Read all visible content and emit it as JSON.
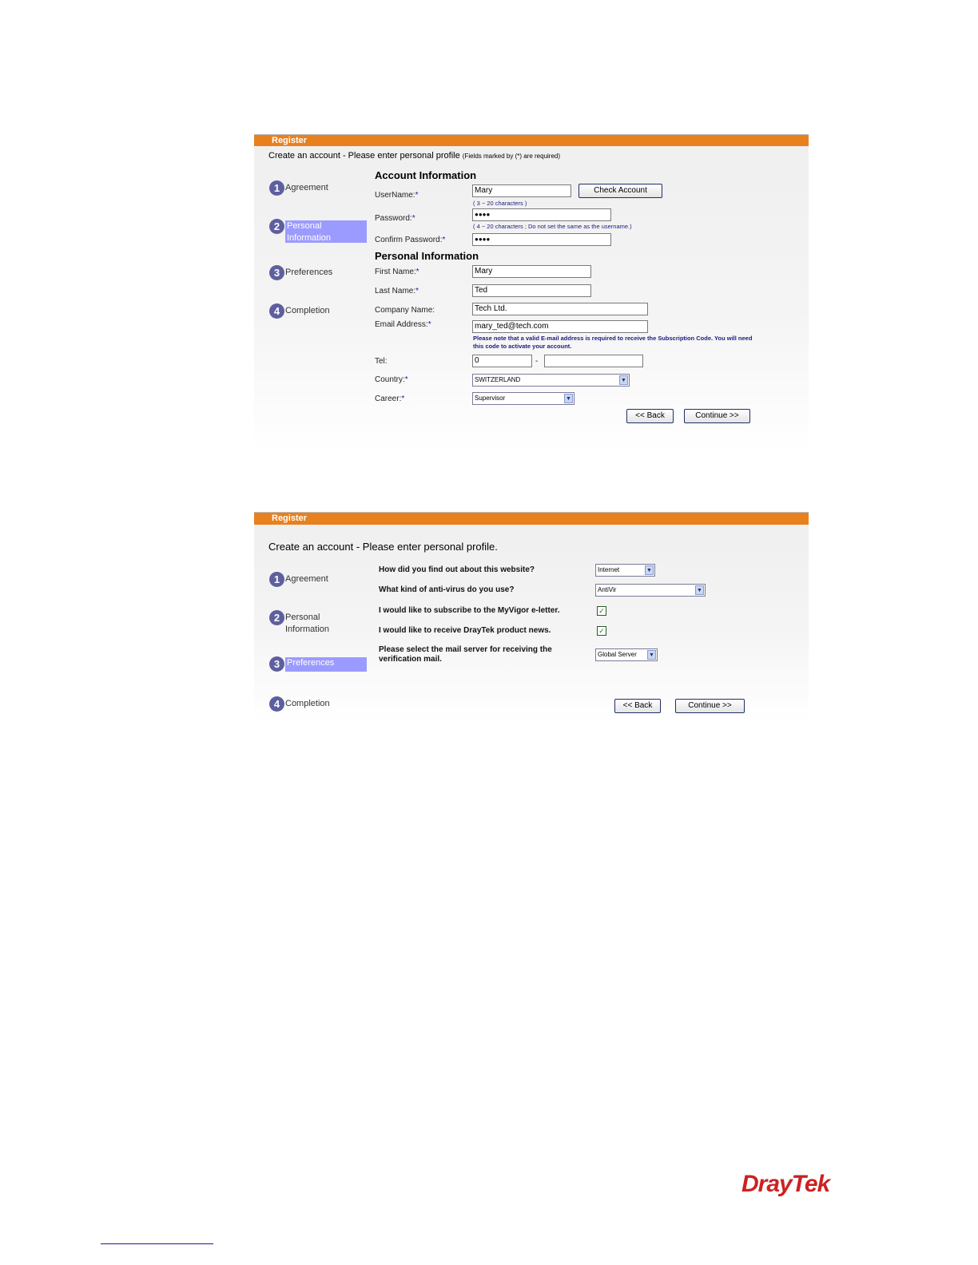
{
  "form1": {
    "header": "Register",
    "subtitle": "Create an account - Please enter personal profile",
    "subtitle_note": "(Fields marked by (*) are required)",
    "steps": [
      {
        "num": "1",
        "label": "Agreement"
      },
      {
        "num": "2",
        "label": "Personal Information"
      },
      {
        "num": "3",
        "label": "Preferences"
      },
      {
        "num": "4",
        "label": "Completion"
      }
    ],
    "account_title": "Account Information",
    "username_label": "UserName:",
    "username_value": "Mary",
    "check_account": "Check Account",
    "username_hint": "( 3 ~ 20 characters )",
    "password_label": "Password:",
    "password_value": "●●●●",
    "password_hint": "( 4 ~ 20 characters ; Do not set the same as the username.)",
    "confirm_label": "Confirm Password:",
    "confirm_value": "●●●●",
    "personal_title": "Personal Information",
    "first_label": "First Name:",
    "first_value": "Mary",
    "last_label": "Last Name:",
    "last_value": "Ted",
    "company_label": "Company Name:",
    "company_value": "Tech Ltd.",
    "email_label": "Email Address:",
    "email_value": "mary_ted@tech.com",
    "email_note": "Please note that a valid E-mail address is required to receive the Subscription Code. You will need this code to activate your account.",
    "tel_label": "Tel:",
    "tel_value1": "0",
    "tel_dash": "-",
    "tel_value2": "",
    "country_label": "Country:",
    "country_value": "SWITZERLAND",
    "career_label": "Career:",
    "career_value": "Supervisor",
    "req": "*",
    "back": "<< Back",
    "continue": "Continue >>"
  },
  "form2": {
    "header": "Register",
    "subtitle": "Create an account - Please enter personal profile.",
    "steps": [
      {
        "num": "1",
        "label": "Agreement"
      },
      {
        "num": "2",
        "label": "Personal Information"
      },
      {
        "num": "3",
        "label": "Preferences"
      },
      {
        "num": "4",
        "label": "Completion"
      }
    ],
    "q1": "How did you find out about this website?",
    "q1_value": "Internet",
    "q2": "What kind of anti-virus do you use?",
    "q2_value": "AntiVir",
    "q3": "I would like to subscribe to the MyVigor e-letter.",
    "q3_checked": "✓",
    "q4": "I would like to receive DrayTek product news.",
    "q4_checked": "✓",
    "q5": "Please select the mail server for receiving the verification mail.",
    "q5_value": "Global Server",
    "back": "<< Back",
    "continue": "Continue >>"
  },
  "logo_text": "DrayTek",
  "colors": {
    "orange": "#e8801e",
    "step_circle": "#5e5f9e",
    "active_step": "#9b9bff",
    "link_blue": "#1a1a99"
  }
}
